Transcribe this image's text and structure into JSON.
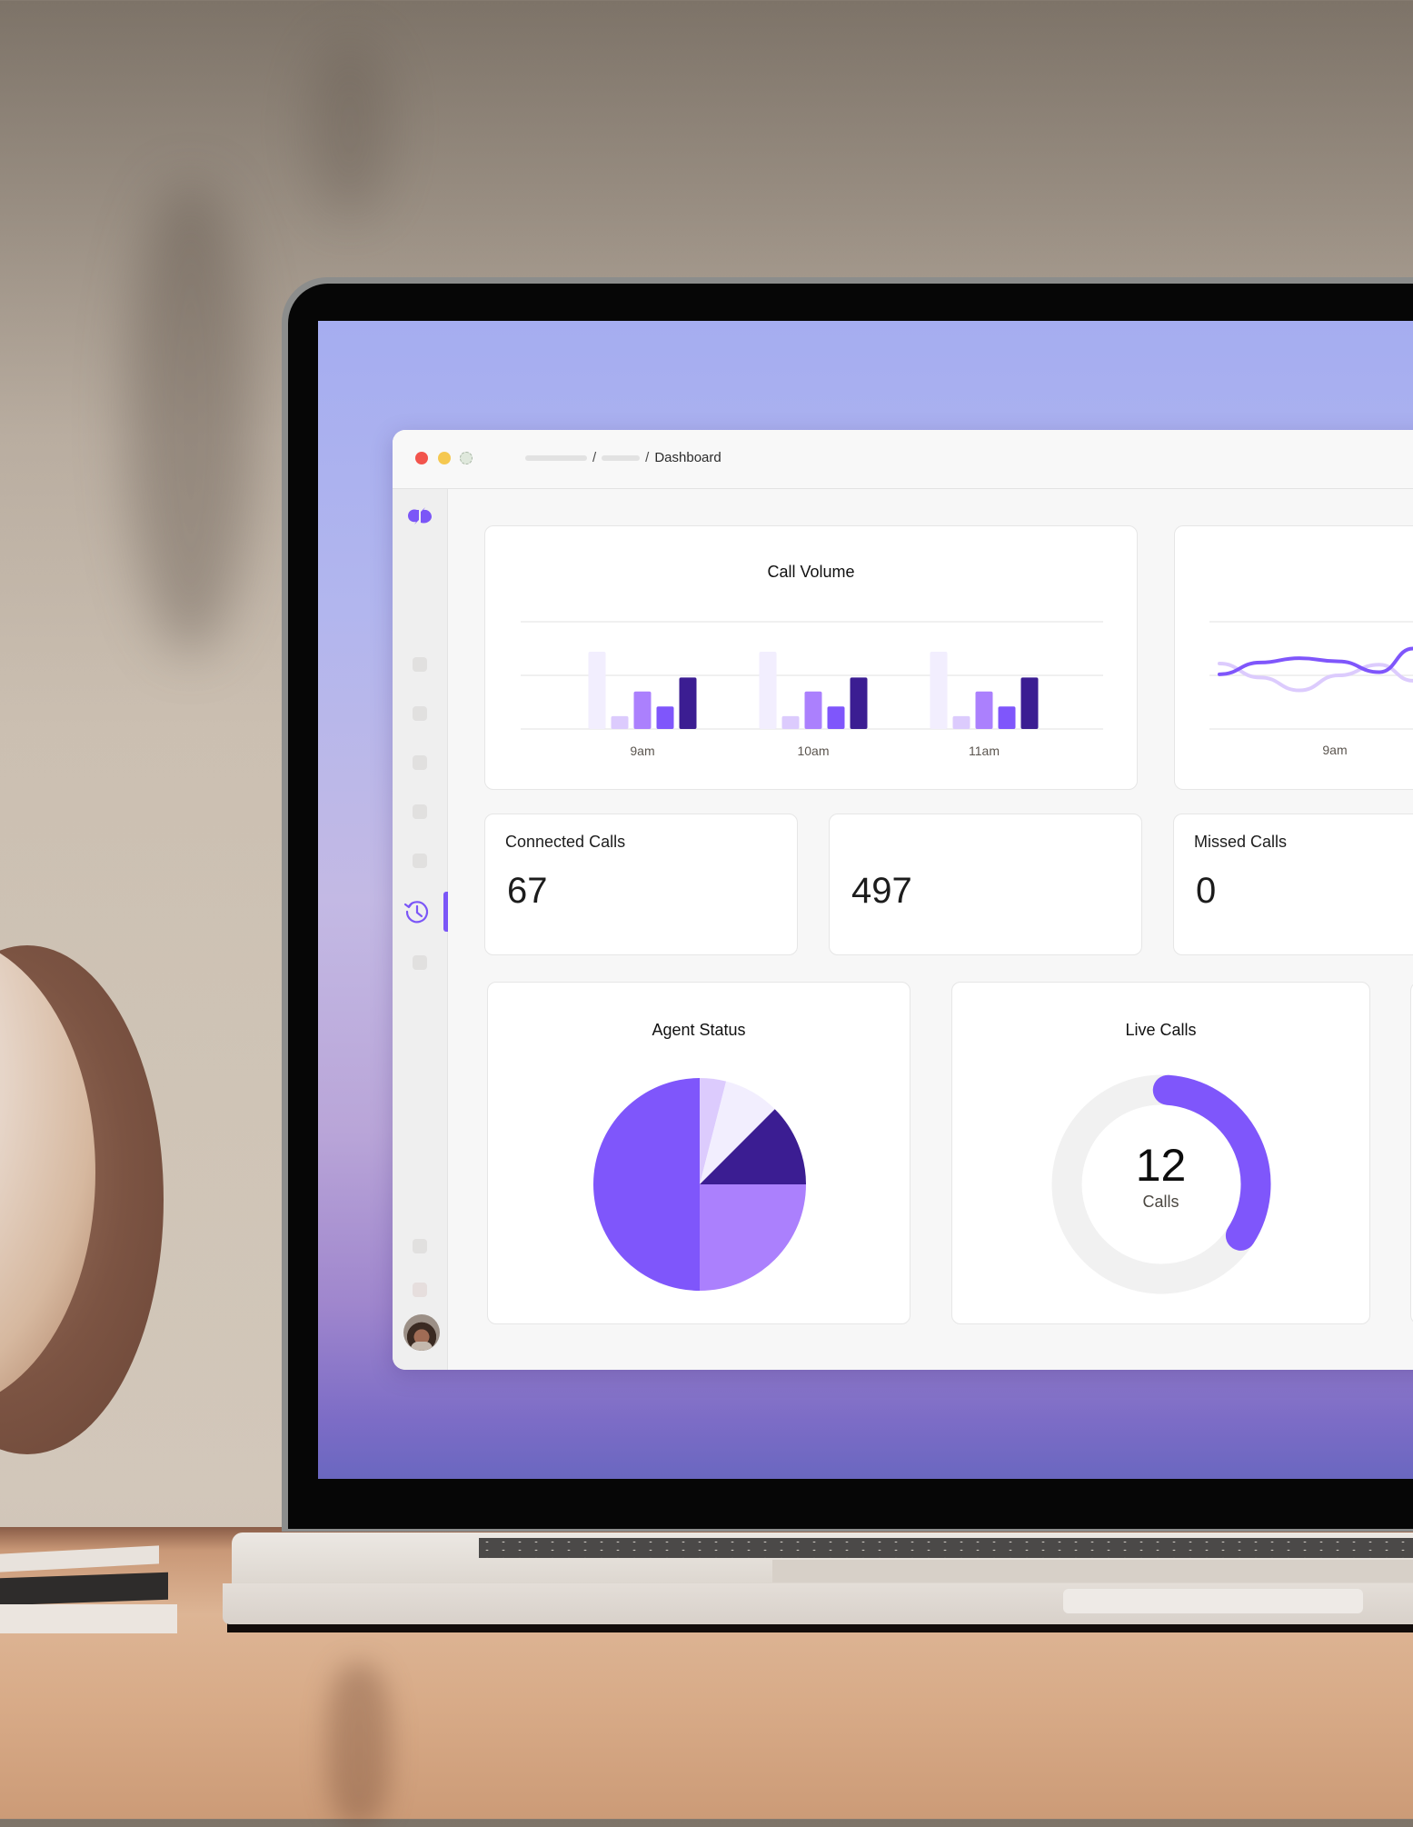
{
  "window": {
    "breadcrumb": {
      "current": "Dashboard",
      "separator": "/"
    }
  },
  "sidebar": {
    "active_item_icon": "history-icon",
    "placeholder_items": 7,
    "accent": "#7b56f7"
  },
  "cards": {
    "call_volume": {
      "title": "Call Volume"
    },
    "trend": {
      "x_label": "9am"
    },
    "stats": [
      {
        "label": "Connected Calls",
        "value": "67"
      },
      {
        "label": "",
        "value": "497"
      },
      {
        "label": "Missed Calls",
        "value": "0"
      }
    ],
    "agent_status": {
      "title": "Agent Status"
    },
    "live_calls": {
      "title": "Live Calls",
      "value": "12",
      "unit": "Calls",
      "fraction": 0.33
    }
  },
  "colors": {
    "purple": "#7f56fb",
    "dark_indigo": "#3b1d92",
    "medium_purple": "#ab80fd",
    "light_lavender": "#dccbfd",
    "pale_lavender": "#f2eefe",
    "track": "#f1f1f1",
    "grid": "#e7e7e7"
  },
  "chart_data": [
    {
      "type": "bar",
      "title": "Call Volume",
      "categories": [
        "9am",
        "10am",
        "11am"
      ],
      "series": [
        {
          "name": "series-1",
          "color": "#f2eefe",
          "values": [
            72,
            72,
            72
          ]
        },
        {
          "name": "series-2",
          "color": "#dccbfd",
          "values": [
            12,
            12,
            12
          ]
        },
        {
          "name": "series-3",
          "color": "#ab80fd",
          "values": [
            35,
            35,
            35
          ]
        },
        {
          "name": "series-4",
          "color": "#7f56fb",
          "values": [
            21,
            21,
            21
          ]
        },
        {
          "name": "series-5",
          "color": "#3b1d92",
          "values": [
            48,
            48,
            48
          ]
        }
      ],
      "ylim": [
        0,
        100
      ],
      "gridlines": [
        0,
        50,
        100
      ],
      "grid": true,
      "xlabel": "",
      "ylabel": ""
    },
    {
      "type": "line",
      "title": "",
      "categories": [
        "9am"
      ],
      "x": [
        0,
        1,
        2,
        3,
        4,
        5
      ],
      "series": [
        {
          "name": "primary",
          "color": "#7f56fb",
          "values": [
            51,
            62,
            66,
            63,
            53,
            75
          ]
        },
        {
          "name": "secondary",
          "color": "#dccbfd",
          "values": [
            61,
            48,
            36,
            50,
            60,
            45
          ]
        }
      ],
      "ylim": [
        0,
        100
      ],
      "gridlines": [
        0,
        50,
        100
      ],
      "grid": true
    },
    {
      "type": "pie",
      "title": "Agent Status",
      "slices": [
        {
          "label": "slice-1",
          "value": 4,
          "color": "#dccbfd"
        },
        {
          "label": "slice-2",
          "value": 8.5,
          "color": "#f2eefe"
        },
        {
          "label": "slice-3",
          "value": 12.5,
          "color": "#3b1d92"
        },
        {
          "label": "slice-4",
          "value": 25,
          "color": "#ab80fd"
        },
        {
          "label": "slice-5",
          "value": 50,
          "color": "#7f56fb"
        }
      ]
    }
  ]
}
